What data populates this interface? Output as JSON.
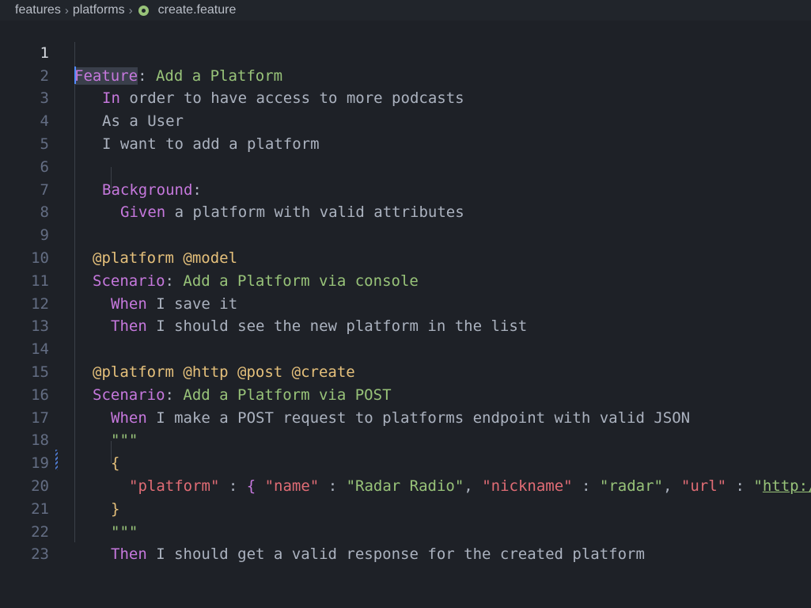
{
  "breadcrumb": {
    "items": [
      "features",
      "platforms"
    ],
    "file": "create.feature"
  },
  "editor": {
    "active_line": 1,
    "line_numbers": [
      "1",
      "2",
      "3",
      "4",
      "5",
      "6",
      "7",
      "8",
      "9",
      "10",
      "11",
      "12",
      "13",
      "14",
      "15",
      "16",
      "17",
      "18",
      "19",
      "20",
      "21",
      "22",
      "23"
    ],
    "lines": {
      "l1_kw": "Feature",
      "l1_colon": ": ",
      "l1_title": "Add a Platform",
      "l2_kw": "In",
      "l2_text": " order to have access to more podcasts",
      "l3_text": "As a User",
      "l4_text": "I want to add a platform",
      "l6_kw": "Background",
      "l6_colon": ":",
      "l7_kw": "Given",
      "l7_text": " a platform with valid attributes",
      "l9_tags": "@platform @model",
      "l10_kw": "Scenario",
      "l10_colon": ": ",
      "l10_title": "Add a Platform via console",
      "l11_kw": "When",
      "l11_text": " I save it",
      "l12_kw": "Then",
      "l12_text": " I should see the new platform in the list",
      "l14_tags": "@platform @http @post @create",
      "l15_kw": "Scenario",
      "l15_colon": ": ",
      "l15_title": "Add a Platform via POST",
      "l16_kw": "When",
      "l16_text": " I make a POST request to platforms endpoint with valid JSON",
      "l17_doc": "\"\"\"",
      "l18_brace": "{",
      "l19_k1": "\"platform\"",
      "l19_p1": " : ",
      "l19_b1": "{",
      "l19_k2": " \"name\"",
      "l19_p2": " : ",
      "l19_v2": "\"Radar Radio\"",
      "l19_p3": ", ",
      "l19_k3": "\"nickname\"",
      "l19_p4": " : ",
      "l19_v3": "\"radar\"",
      "l19_p5": ", ",
      "l19_k4": "\"url\"",
      "l19_p6": " : ",
      "l19_v4": "\"",
      "l19_url": "http://www.radarradio.com",
      "l20_brace": "}",
      "l21_doc": "\"\"\"",
      "l22_kw": "Then",
      "l22_text": " I should get a valid response for the created platform"
    }
  }
}
